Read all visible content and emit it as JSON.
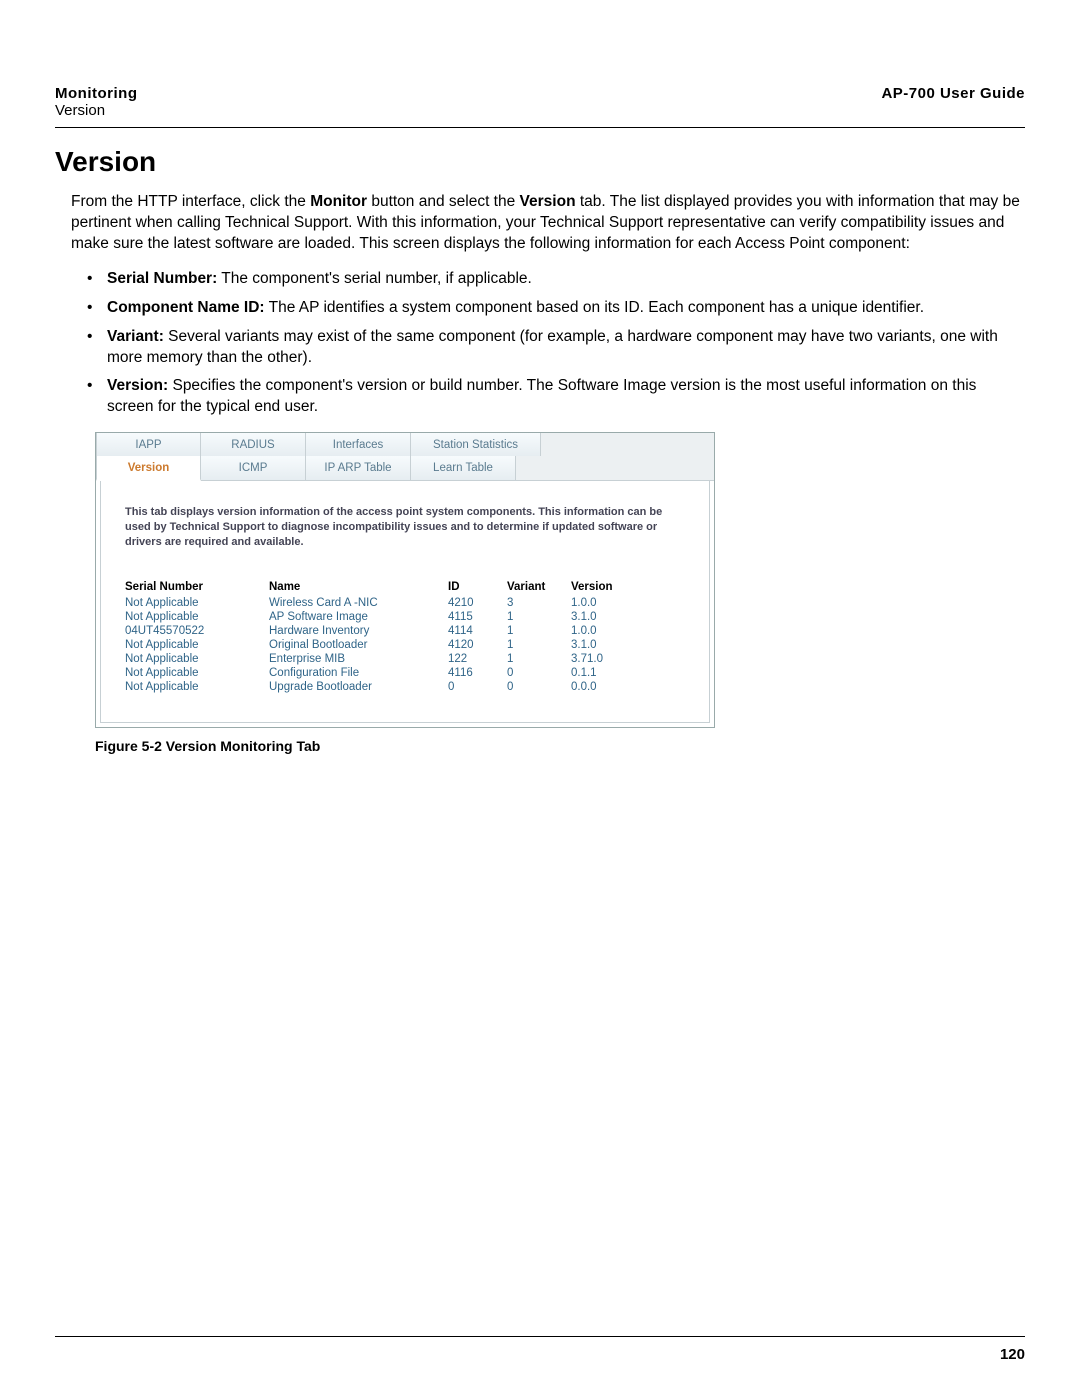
{
  "header": {
    "section": "Monitoring",
    "subsection": "Version",
    "guide": "AP-700 User Guide"
  },
  "page_number": "120",
  "title": "Version",
  "intro_parts": {
    "p1a": "From the HTTP interface, click the ",
    "p1b": "Monitor",
    "p1c": " button and select the ",
    "p1d": "Version",
    "p1e": " tab. The list displayed provides you with information that may be pertinent when calling Technical Support. With this information, your Technical Support representative can verify compatibility issues and make sure the latest software are loaded. This screen displays the following information for each Access Point component:"
  },
  "bullets": [
    {
      "label": "Serial Number:",
      "text": " The component's serial number, if applicable."
    },
    {
      "label": "Component Name ID:",
      "text": " The AP identifies a system component based on its ID. Each component has a unique identifier."
    },
    {
      "label": "Variant:",
      "text": " Several variants may exist of the same component (for example, a hardware component may have two variants, one with more memory than the other)."
    },
    {
      "label": "Version:",
      "text": " Specifies the component's version or build number. The Software Image version is the most useful information on this screen for the typical end user."
    }
  ],
  "figure": {
    "tabs_top": [
      "IAPP",
      "RADIUS",
      "Interfaces",
      "Station Statistics"
    ],
    "tabs_bottom": [
      "Version",
      "ICMP",
      "IP ARP Table",
      "Learn Table"
    ],
    "active_tab": "Version",
    "description": "This tab displays version information of the access point system components. This information can be used by Technical Support to diagnose incompatibility issues and to determine if updated software or drivers are required and available.",
    "columns": [
      "Serial Number",
      "Name",
      "ID",
      "Variant",
      "Version"
    ],
    "rows": [
      {
        "serial": "Not Applicable",
        "name": "Wireless Card A -NIC",
        "id": "4210",
        "variant": "3",
        "version": "1.0.0"
      },
      {
        "serial": "Not Applicable",
        "name": "AP Software Image",
        "id": "4115",
        "variant": "1",
        "version": "3.1.0"
      },
      {
        "serial": "04UT45570522",
        "name": "Hardware Inventory",
        "id": "4114",
        "variant": "1",
        "version": "1.0.0"
      },
      {
        "serial": "Not Applicable",
        "name": "Original Bootloader",
        "id": "4120",
        "variant": "1",
        "version": "3.1.0"
      },
      {
        "serial": "Not Applicable",
        "name": "Enterprise MIB",
        "id": "122",
        "variant": "1",
        "version": "3.71.0"
      },
      {
        "serial": "Not Applicable",
        "name": "Configuration File",
        "id": "4116",
        "variant": "0",
        "version": "0.1.1"
      },
      {
        "serial": "Not Applicable",
        "name": "Upgrade Bootloader",
        "id": "0",
        "variant": "0",
        "version": "0.0.0"
      }
    ],
    "caption": "Figure 5-2 Version Monitoring Tab"
  }
}
